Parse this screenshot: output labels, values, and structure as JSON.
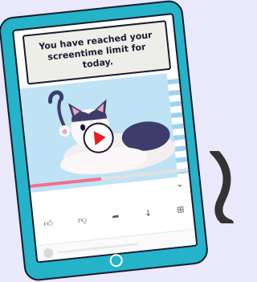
{
  "banner": {
    "message": "You have reached your screentime limit for today."
  },
  "video": {
    "progress": 0.45
  },
  "colors": {
    "background": "#eae8fb",
    "device_frame": "#24b3c9",
    "play_button": "#e51c1c",
    "progress": "#f2708c"
  },
  "icons": {
    "expand": "chevron-down-icon",
    "like": "thumbs-up-icon",
    "dislike": "thumbs-down-icon",
    "share": "share-icon",
    "download": "download-icon",
    "save": "add-to-playlist-icon"
  }
}
